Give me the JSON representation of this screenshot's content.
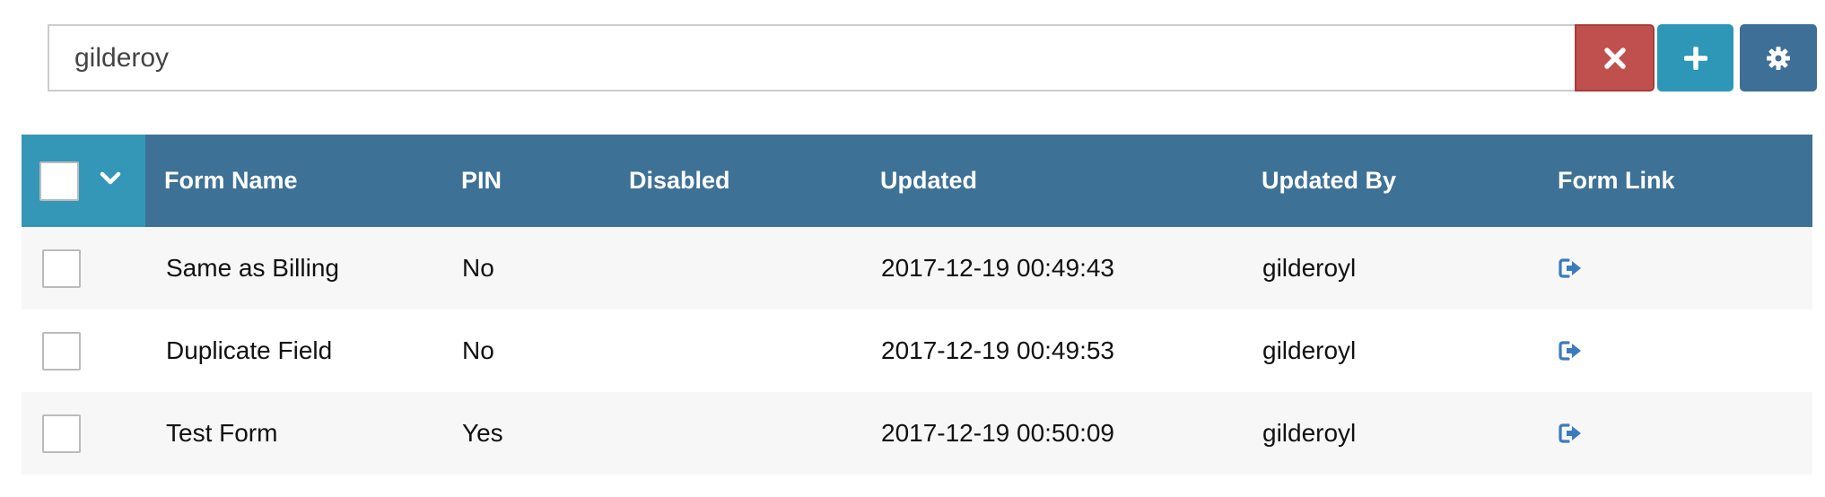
{
  "search": {
    "value": "gilderoy",
    "clear_icon": "close-icon",
    "add_icon": "plus-icon",
    "settings_icon": "gear-icon"
  },
  "table": {
    "columns": [
      "Form Name",
      "PIN",
      "Disabled",
      "Updated",
      "Updated By",
      "Form Link"
    ],
    "rows": [
      {
        "form_name": "Same as Billing",
        "pin": "No",
        "disabled": "",
        "updated": "2017-12-19 00:49:43",
        "updated_by": "gilderoyl",
        "form_link_icon": "sign-out-icon"
      },
      {
        "form_name": "Duplicate Field",
        "pin": "No",
        "disabled": "",
        "updated": "2017-12-19 00:49:53",
        "updated_by": "gilderoyl",
        "form_link_icon": "sign-out-icon"
      },
      {
        "form_name": "Test Form",
        "pin": "Yes",
        "disabled": "",
        "updated": "2017-12-19 00:50:09",
        "updated_by": "gilderoyl",
        "form_link_icon": "sign-out-icon"
      }
    ]
  },
  "colors": {
    "header_bg": "#3e7196",
    "select_cell_bg": "#3497b8",
    "clear_button": "#c0504e",
    "add_button": "#2e96b7",
    "settings_button": "#3e6f96",
    "link_icon": "#3a7bc0"
  }
}
